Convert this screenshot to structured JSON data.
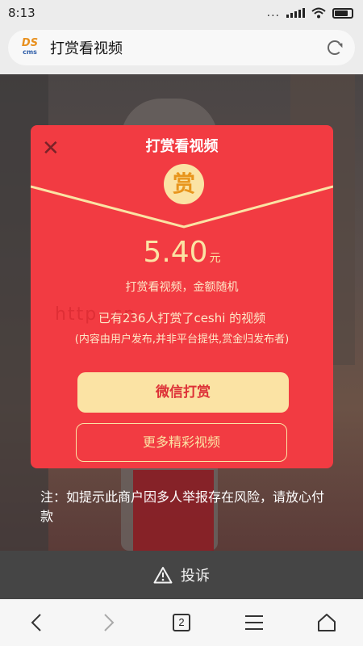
{
  "status_bar": {
    "time": "8:13",
    "dots": "..."
  },
  "browser": {
    "logo_line1": "DS",
    "logo_line2": "cms",
    "page_title": "打赏看视频"
  },
  "modal": {
    "title": "打赏看视频",
    "badge": "赏",
    "amount": "5.40",
    "unit": "元",
    "subtitle": "打赏看视频，金额随机",
    "count_text": "已有236人打赏了ceshi 的视频",
    "note": "(内容由用户发布,并非平台提供,赏金归发布者)",
    "watermark": "http                         .cn",
    "pay_button": "微信打赏",
    "more_button": "更多精彩视频"
  },
  "warning": "注：如提示此商户因多人举报存在风险，请放心付款",
  "complaint": "投诉",
  "nav": {
    "tab_count": "2"
  },
  "colors": {
    "modal_red": "#f23b42",
    "gold": "#fbe3a4",
    "complaint_bg": "#454545"
  }
}
